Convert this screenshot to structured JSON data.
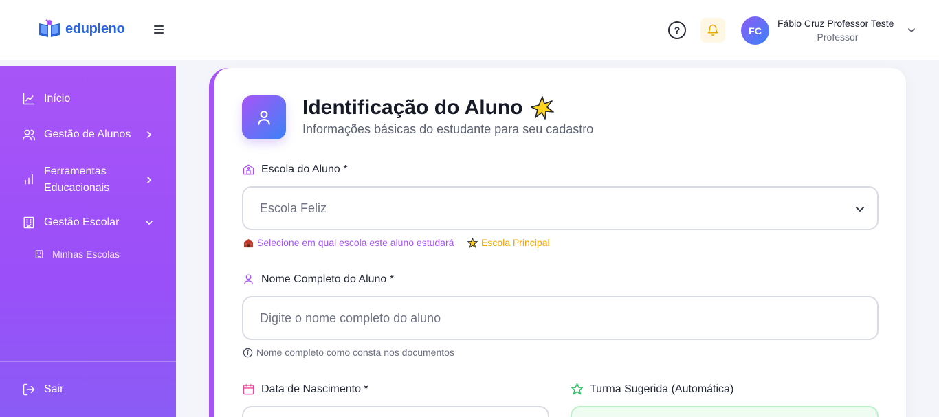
{
  "brand": {
    "name": "edupleno"
  },
  "header": {
    "user_initials": "FC",
    "user_name": "Fábio Cruz Professor Teste",
    "user_role": "Professor",
    "help_icon": "help-circle-icon",
    "bell_icon": "bell-icon"
  },
  "sidebar": {
    "items": [
      {
        "label": "Início",
        "icon": "chart-line-icon"
      },
      {
        "label": "Gestão de Alunos",
        "icon": "users-icon"
      },
      {
        "label": "Ferramentas Educacionais",
        "label_line1": "Ferramentas",
        "label_line2": "Educacionais",
        "icon": "bar-chart-icon"
      },
      {
        "label": "Gestão Escolar",
        "icon": "building-icon"
      }
    ],
    "subitems": [
      {
        "label": "Minhas Escolas",
        "icon": "building-icon"
      }
    ],
    "logout_label": "Sair"
  },
  "form": {
    "title": "Identificação do Aluno",
    "subtitle": "Informações básicas do estudante para seu cadastro",
    "escola": {
      "label": "Escola do Aluno *",
      "selected": "Escola Feliz",
      "hint": "Selecione em qual escola este aluno estudará",
      "badge": "Escola Principal"
    },
    "nome": {
      "label": "Nome Completo do Aluno *",
      "placeholder": "Digite o nome completo do aluno",
      "hint": "Nome completo como consta nos documentos"
    },
    "nascimento": {
      "label": "Data de Nascimento *"
    },
    "turma": {
      "label": "Turma Sugerida (Automática)"
    }
  },
  "colors": {
    "brand_blue": "#2b63d9",
    "sidebar_purple": "#a855f7",
    "accent_gold": "#f0a500",
    "success_green": "#22c55e"
  }
}
